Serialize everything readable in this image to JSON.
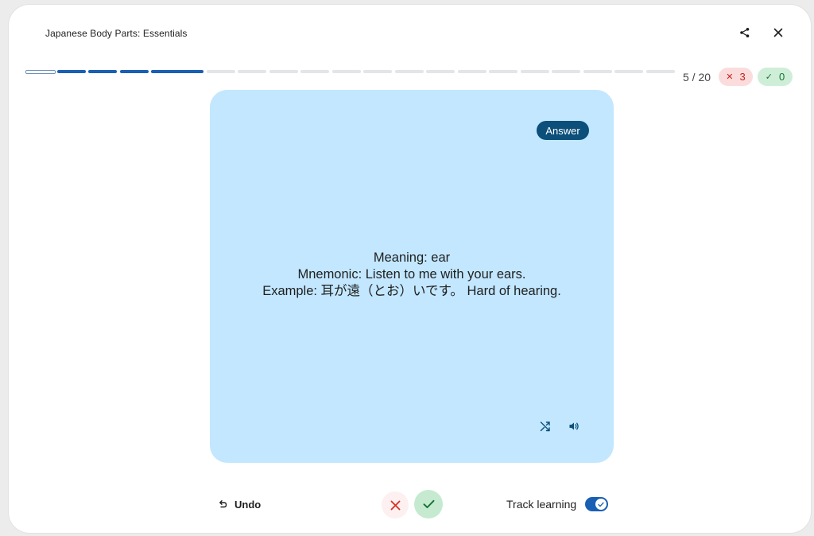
{
  "header": {
    "title": "Japanese Body Parts: Essentials",
    "share_icon": "share-icon",
    "close_icon": "close-icon"
  },
  "progress": {
    "current": 5,
    "total": 20,
    "label": "5 / 20",
    "completed_segments": 4,
    "accent_color": "#1a5fb4"
  },
  "score": {
    "wrong_icon": "✕",
    "wrong_count": "3",
    "right_icon": "✓",
    "right_count": "0",
    "wrong_color": "#c5221f",
    "right_color": "#137333"
  },
  "card": {
    "chip_label": "Answer",
    "lines": [
      "Meaning: ear",
      "Mnemonic: Listen to me with your ears.",
      "Example: 耳が遠（とお）いです。 Hard of hearing."
    ],
    "background_color": "#c2e7ff",
    "shuffle_icon": "shuffle-icon",
    "audio_icon": "volume-icon"
  },
  "footer": {
    "undo_label": "Undo",
    "track_label": "Track learning",
    "track_enabled": true
  }
}
